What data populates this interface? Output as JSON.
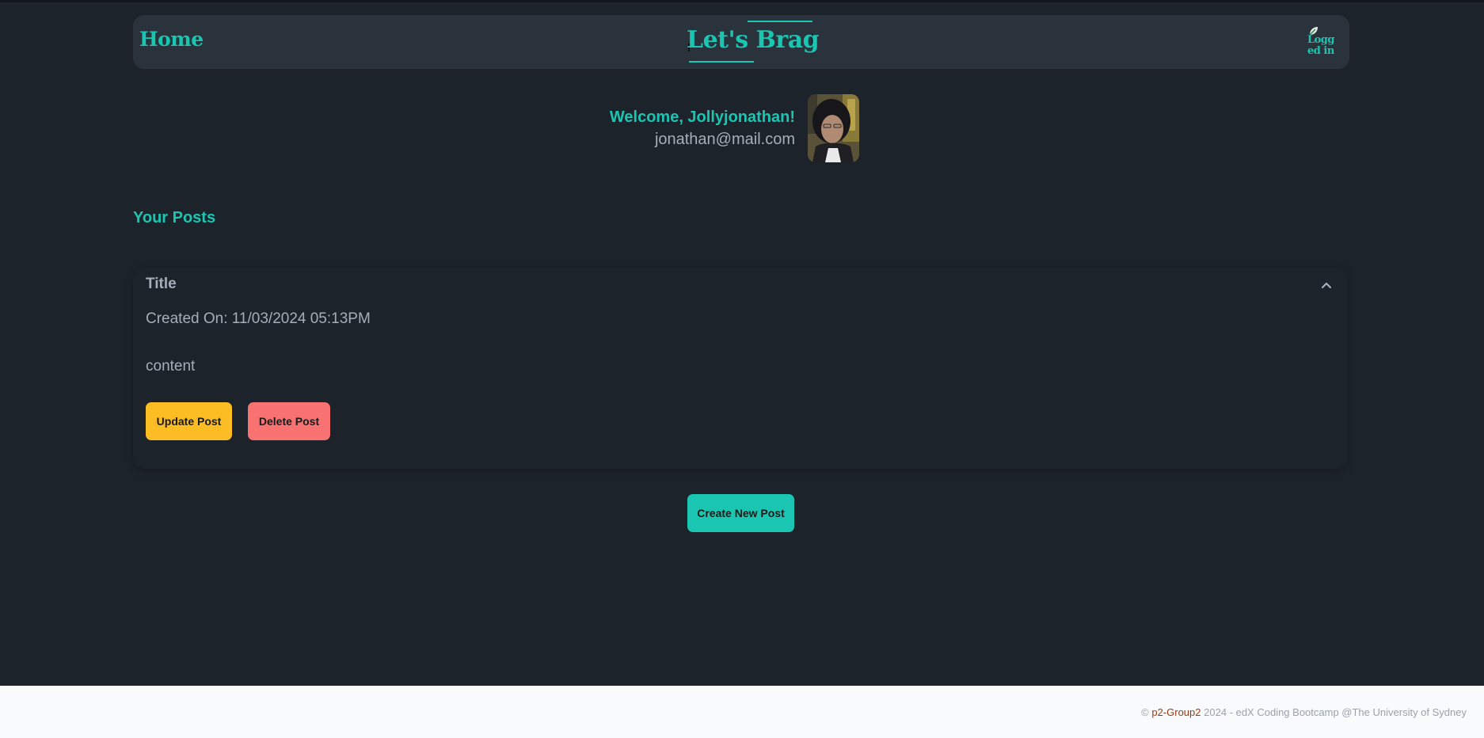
{
  "navbar": {
    "home_label": "Home",
    "brand_title": "Let's Brag",
    "status_text": "Logged in"
  },
  "profile": {
    "welcome": "Welcome, Jollyjonathan!",
    "email": "jonathan@mail.com"
  },
  "posts_section": {
    "title": "Your Posts",
    "posts": [
      {
        "title": "Title",
        "created_on": "Created On: 11/03/2024 05:13PM",
        "content": "content",
        "update_label": "Update Post",
        "delete_label": "Delete Post"
      }
    ]
  },
  "create_button": "Create New Post",
  "footer": {
    "copyright_symbol": "©",
    "group_link": "p2-Group2",
    "rest": "2024 - edX Coding Bootcamp @The University of Sydney"
  },
  "colors": {
    "background": "#1d232a",
    "navbar": "#2a323c",
    "accent": "#1ac6b2",
    "text": "#a6adbb",
    "warning": "#fbbd23",
    "error": "#f87272",
    "footer_bg": "#f9fafc"
  },
  "icons": {
    "status": "logged-in-status-icon",
    "collapse": "chevron-up-icon"
  }
}
